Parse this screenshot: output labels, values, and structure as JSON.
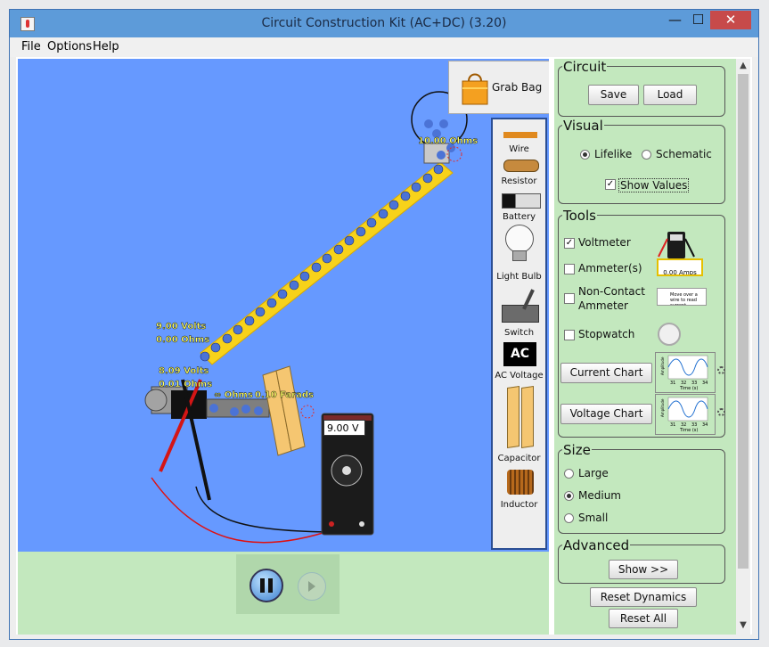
{
  "window": {
    "title": "Circuit Construction Kit (AC+DC) (3.20)",
    "minimize": "—",
    "maximize": "☐",
    "close": "✕"
  },
  "menu": {
    "file": "File",
    "options": "Options",
    "help": "Help"
  },
  "canvas": {
    "grab_bag_label": "Grab Bag",
    "bulb_label": "10.00 Ohms",
    "battery_volts": "9.00 Volts",
    "battery_ohms": "0.00 Ohms",
    "source_volts": "8.09 Volts",
    "source_ohms": "0.01 Ohms",
    "switch_label": "∞ Ohms",
    "capacitor_label": "0.10 Farads",
    "voltmeter_reading": "9.00 V"
  },
  "toolbox": {
    "wire": "Wire",
    "resistor": "Resistor",
    "battery": "Battery",
    "light_bulb": "Light Bulb",
    "switch": "Switch",
    "ac_icon_text": "AC",
    "ac_voltage": "AC Voltage",
    "capacitor": "Capacitor",
    "inductor": "Inductor"
  },
  "panel": {
    "circuit": {
      "title": "Circuit",
      "save": "Save",
      "load": "Load"
    },
    "visual": {
      "title": "Visual",
      "lifelike": "Lifelike",
      "schematic": "Schematic",
      "show_values": "Show Values",
      "selected": "lifelike",
      "show_values_checked": true
    },
    "tools": {
      "title": "Tools",
      "voltmeter": "Voltmeter",
      "ammeters": "Ammeter(s)",
      "noncontact_1": "Non-Contact",
      "noncontact_2": "Ammeter",
      "stopwatch": "Stopwatch",
      "current_chart": "Current Chart",
      "voltage_chart": "Voltage Chart",
      "ammeter_icon_text": "0.00 Amps",
      "noncontact_icon_text": "Move over a wire to read current",
      "chart_axis_x": "Time (s)",
      "chart_axis_y": "Amplitude",
      "chart_ticks": [
        "31",
        "32",
        "33",
        "34"
      ],
      "voltmeter_checked": true
    },
    "size": {
      "title": "Size",
      "large": "Large",
      "medium": "Medium",
      "small": "Small",
      "selected": "medium"
    },
    "advanced": {
      "title": "Advanced",
      "show": "Show >>"
    },
    "reset_dynamics": "Reset Dynamics",
    "reset_all": "Reset All"
  },
  "colors": {
    "canvas": "#6699ff",
    "panel": "#c3e8be",
    "titlebar": "#5d9bd9"
  }
}
